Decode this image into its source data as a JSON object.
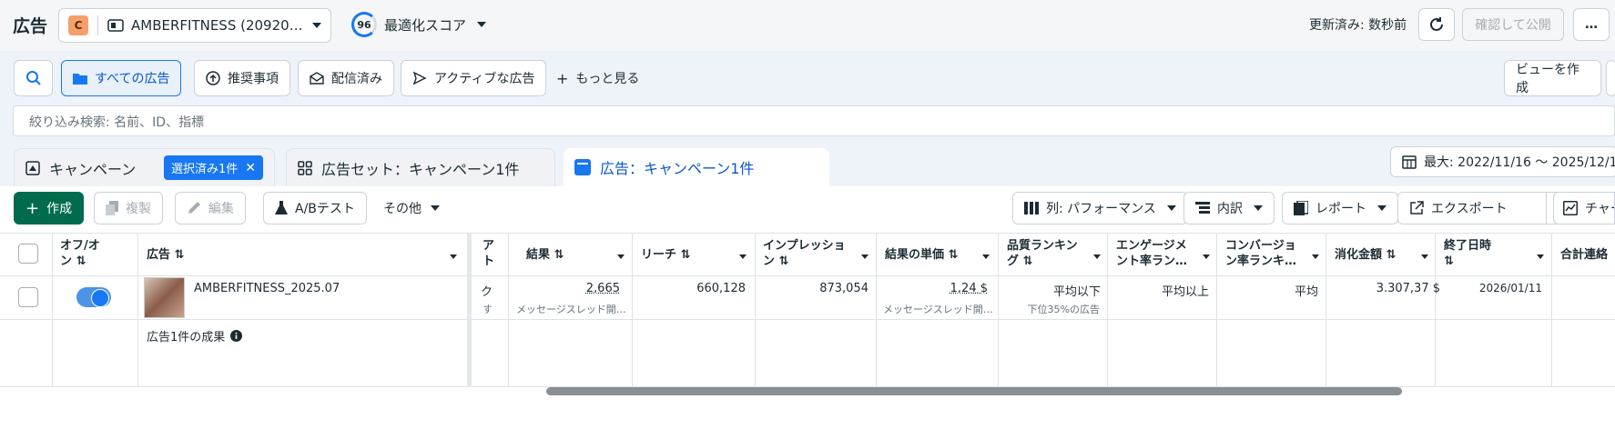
{
  "header": {
    "title": "広告",
    "account_badge": "C",
    "account_name": "AMBERFITNESS (20920…",
    "score_value": "96",
    "score_label": "最適化スコア",
    "updated": "更新済み: 数秒前",
    "publish_label": "確認して公開",
    "more_label": "…"
  },
  "filters": {
    "all_ads": "すべての広告",
    "recommendations": "推奨事項",
    "delivered": "配信済み",
    "active_ads": "アクティブな広告",
    "more": "もっと見る",
    "create_view": "ビューを作成",
    "search_placeholder": "絞り込み検索: 名前、ID、指標"
  },
  "tabs": {
    "campaign": "キャンペーン",
    "campaign_chip": "選択済み1件",
    "adset": "広告セット：キャンペーン1件",
    "ad": "広告：キャンペーン1件",
    "date_range": "最大: 2022/11/16 〜 2025/12/16"
  },
  "toolbar": {
    "create": "作成",
    "duplicate": "複製",
    "edit": "編集",
    "ab_test": "A/Bテスト",
    "other": "その他",
    "columns": "列: パフォーマンス",
    "breakdown": "内訳",
    "reports": "レポート",
    "export": "エクスポート",
    "chart": "チャー"
  },
  "table": {
    "headers": {
      "toggle": [
        "オフ/オ",
        "ン ⇅"
      ],
      "ad": "広告 ⇅",
      "art": [
        "ア",
        "ト"
      ],
      "results": "結果 ⇅",
      "reach": "リーチ ⇅",
      "impressions": [
        "インプレッショ",
        "ン ⇅"
      ],
      "cost_per_result": "結果の単価 ⇅",
      "quality": [
        "品質ランキン",
        "グ ⇅"
      ],
      "engagement": [
        "エンゲージメ",
        "ント率ラン…"
      ],
      "conversion": [
        "コンバージョ",
        "ン率ランキ…"
      ],
      "spend": "消化金額 ⇅",
      "end_date": [
        "終了日時",
        "⇅"
      ],
      "total": "合計連絡"
    },
    "row": {
      "ad_name": "AMBERFITNESS_2025.07",
      "art_1": "ク",
      "art_2": "す",
      "results": "2,665",
      "results_sub": "メッセージスレッド開…",
      "reach": "660,128",
      "impressions": "873,054",
      "cost_per_result": "1,24 $",
      "cost_sub": "メッセージスレッド開…",
      "quality": "平均以下",
      "quality_sub": "下位35%の広告",
      "engagement": "平均以上",
      "conversion": "平均",
      "spend": "3.307,37 $",
      "end_date": "2026/01/11"
    },
    "summary_label": "広告1件の成果"
  },
  "colors": {
    "accent": "#1877f2",
    "create_green": "#006b4d"
  }
}
